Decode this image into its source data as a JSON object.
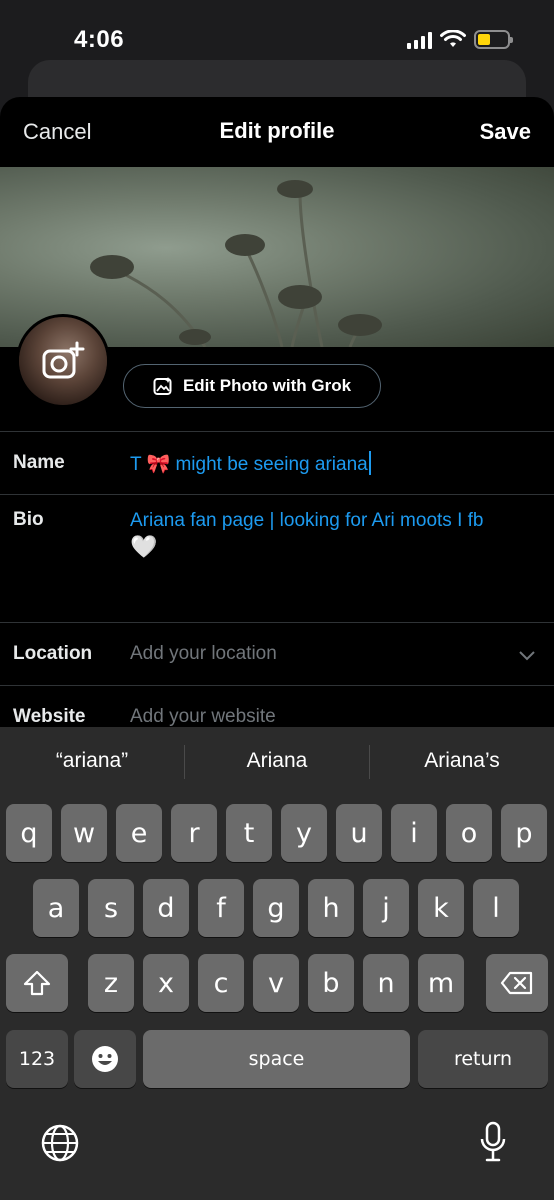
{
  "status_bar": {
    "time": "4:06",
    "battery_color": "#ffd60a"
  },
  "nav": {
    "cancel": "Cancel",
    "title": "Edit profile",
    "save": "Save"
  },
  "profile": {
    "edit_photo_label": "Edit Photo with Grok",
    "fields": {
      "name": {
        "label": "Name",
        "value": "T 🎀 might be seeing ariana"
      },
      "bio": {
        "label": "Bio",
        "value_line1": "Ariana fan page | looking for Ari moots I fb",
        "value_line2": "🤍"
      },
      "location": {
        "label": "Location",
        "placeholder": "Add your location"
      },
      "website": {
        "label": "Website",
        "placeholder": "Add your website"
      }
    }
  },
  "keyboard": {
    "suggestions": [
      "“ariana”",
      "Ariana",
      "Ariana’s"
    ],
    "row1": [
      "q",
      "w",
      "e",
      "r",
      "t",
      "y",
      "u",
      "i",
      "o",
      "p"
    ],
    "row2": [
      "a",
      "s",
      "d",
      "f",
      "g",
      "h",
      "j",
      "k",
      "l"
    ],
    "row3": [
      "z",
      "x",
      "c",
      "v",
      "b",
      "n",
      "m"
    ],
    "numbers_key": "123",
    "space_key": "space",
    "return_key": "return",
    "icons": {
      "shift": "shift-icon",
      "delete": "delete-icon",
      "emoji": "emoji-icon",
      "globe": "globe-icon",
      "mic": "microphone-icon"
    }
  },
  "colors": {
    "accent": "#1d9bf0",
    "placeholder": "#71767b",
    "background": "#000000"
  }
}
